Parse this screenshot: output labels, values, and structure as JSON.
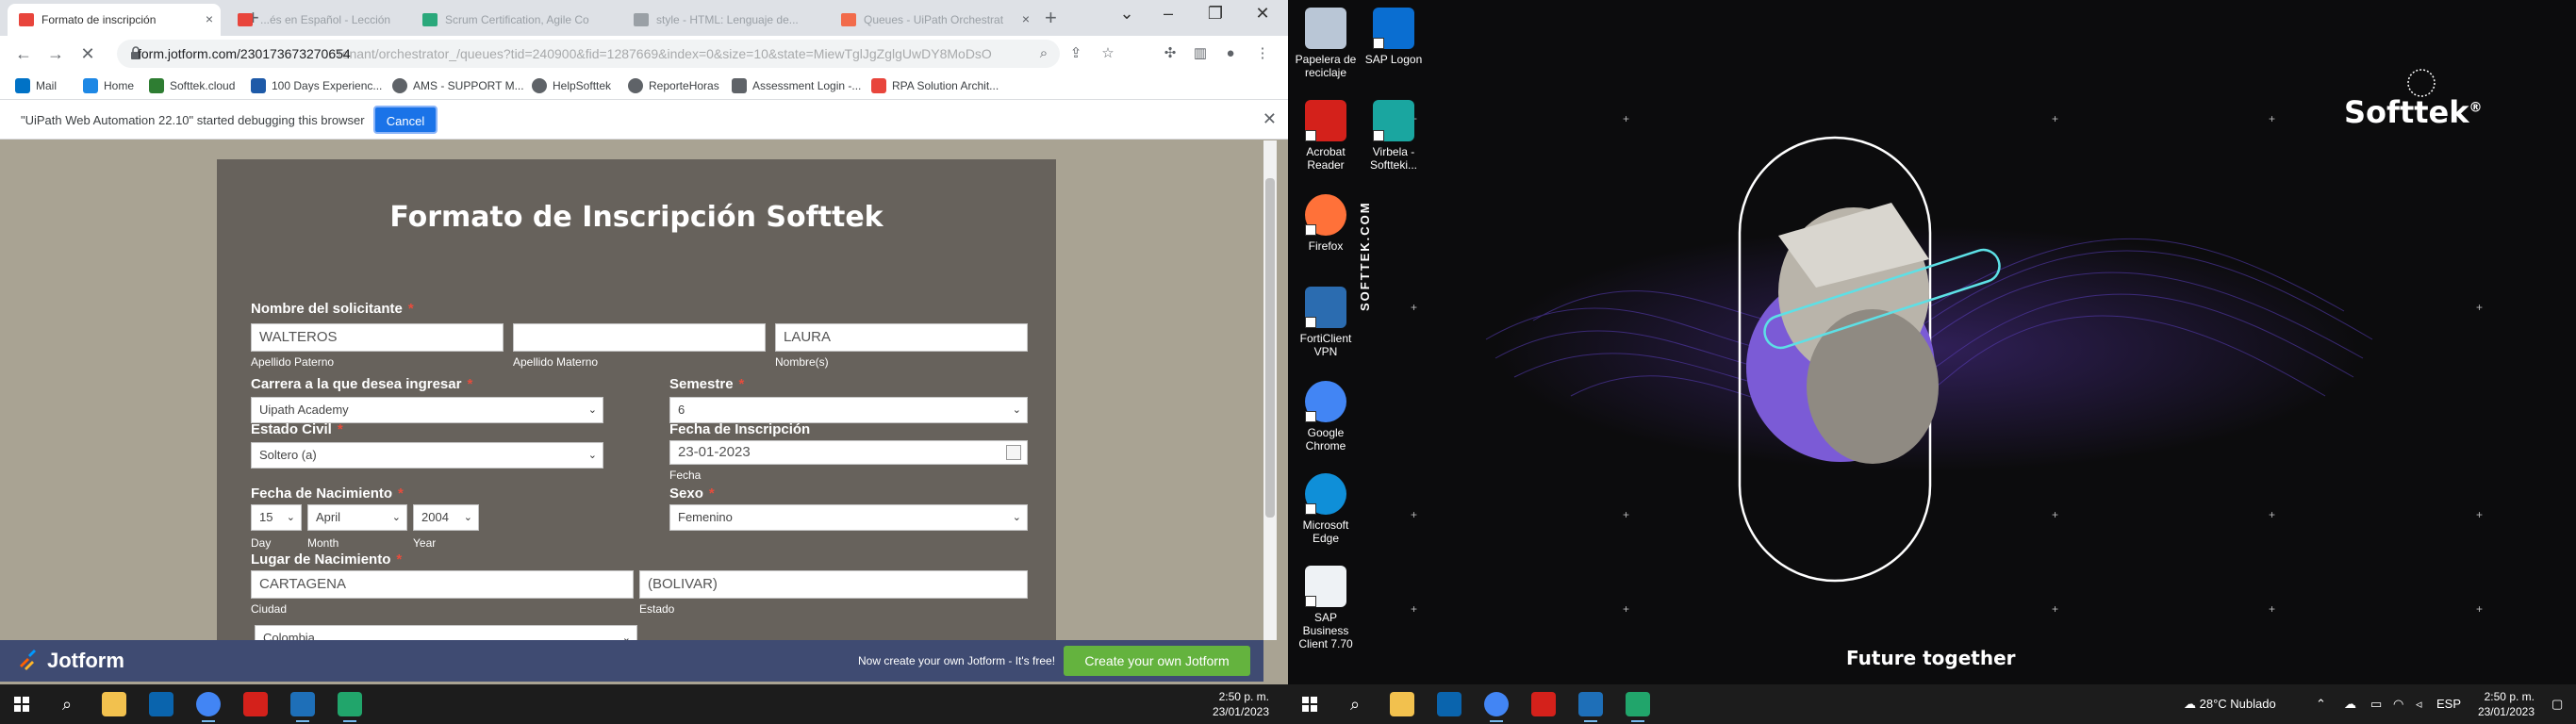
{
  "left": {
    "tabs": [
      {
        "label": "Formato de inscripción",
        "active": true,
        "color": "#e8453c"
      },
      {
        "label": "...és en Español - Lección",
        "active": false,
        "color": "#e8453c"
      },
      {
        "label": "Scrum Certification, Agile Co",
        "active": false,
        "color": "#2aa87b"
      },
      {
        "label": "style - HTML: Lenguaje de...",
        "active": false,
        "color": "#9aa0a6"
      },
      {
        "label": "Queues - UiPath Orchestrat",
        "active": false,
        "color": "#f26b4b"
      }
    ],
    "url": {
      "host": "form.jotform.com/230173673270654",
      "rest": "...Tenant/orchestrator_/queues?tid=240900&fid=1287669&index=0&size=10&state=MiewTglJgZglgUwDY8MoDsO"
    },
    "bookmarks": [
      {
        "label": "Mail",
        "color": "#0072c6"
      },
      {
        "label": "Home",
        "color": "#1e88e5"
      },
      {
        "label": "Softtek.cloud",
        "color": "#2e7d32"
      },
      {
        "label": "100 Days Experienc...",
        "color": "#1e5aa8"
      },
      {
        "label": "AMS - SUPPORT M...",
        "color": "#5f6368"
      },
      {
        "label": "HelpSofttek",
        "color": "#5f6368"
      },
      {
        "label": "ReporteHoras",
        "color": "#5f6368"
      },
      {
        "label": "Assessment Login -...",
        "color": "#5f6368"
      },
      {
        "label": "RPA Solution Archit...",
        "color": "#e8453c"
      }
    ],
    "infobar": {
      "message": "\"UiPath Web Automation 22.10\" started debugging this browser",
      "cancel": "Cancel"
    },
    "form": {
      "title": "Formato de Inscripción Softtek",
      "solicitante": {
        "label": "Nombre del solicitante",
        "paterno": "WALTEROS",
        "materno": "",
        "nombre": "LAURA",
        "sub_paterno": "Apellido Paterno",
        "sub_materno": "Apellido Materno",
        "sub_nombre": "Nombre(s)"
      },
      "carrera": {
        "label": "Carrera a la que desea ingresar",
        "value": "Uipath Academy"
      },
      "semestre": {
        "label": "Semestre",
        "value": "6"
      },
      "estado_civil": {
        "label": "Estado Civil",
        "value": "Soltero (a)"
      },
      "fecha_inscripcion": {
        "label": "Fecha de Inscripción",
        "value": "23-01-2023",
        "sub": "Fecha"
      },
      "nacimiento": {
        "label": "Fecha de Nacimiento",
        "day": "15",
        "month": "April",
        "year": "2004",
        "sub_day": "Day",
        "sub_month": "Month",
        "sub_year": "Year"
      },
      "sexo": {
        "label": "Sexo",
        "value": "Femenino"
      },
      "lugar": {
        "label": "Lugar de Nacimiento",
        "ciudad": "CARTAGENA",
        "estado": "(BOLIVAR)",
        "sub_ciudad": "Ciudad",
        "sub_estado": "Estado",
        "pais": "Colombia"
      }
    },
    "jotbar": {
      "logo": "Jotform",
      "promo": "Now create your own Jotform - It's free!",
      "cta": "Create your own Jotform"
    },
    "clock": {
      "time": "2:50 p. m.",
      "date": "23/01/2023"
    }
  },
  "right": {
    "icons": [
      {
        "label": "Papelera de reciclaje",
        "color": "#b9c6d6"
      },
      {
        "label": "SAP Logon",
        "color": "#0a6ed1"
      },
      {
        "label": "Acrobat Reader",
        "color": "#d4211b"
      },
      {
        "label": "Virbela - Softteki...",
        "color": "#1aa6a0"
      },
      {
        "label": "Firefox",
        "color": "#ff7139"
      },
      {
        "label": "FortiClient VPN",
        "color": "#2b6cb0"
      },
      {
        "label": "Google Chrome",
        "color": "#4285f4"
      },
      {
        "label": "Microsoft Edge",
        "color": "#0f8fd8"
      },
      {
        "label": "SAP Business Client 7.70",
        "color": "#eef2f5"
      }
    ],
    "vertical_text": "SOFTTEK.COM",
    "brand": "Softtek",
    "tagline": "Future together",
    "weather": "28°C  Nublado",
    "lang": "ESP",
    "clock": {
      "time": "2:50 p. m.",
      "date": "23/01/2023"
    }
  }
}
